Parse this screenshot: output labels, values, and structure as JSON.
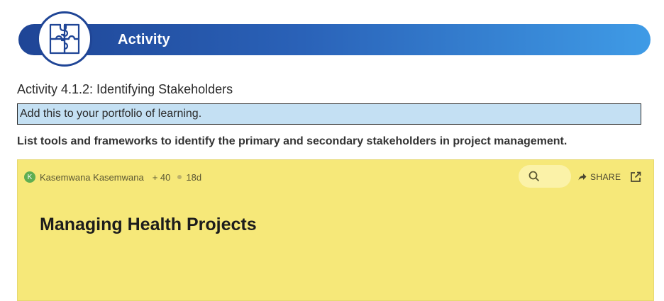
{
  "banner": {
    "title": "Activity",
    "icon": "puzzle-icon"
  },
  "activity": {
    "heading": "Activity 4.1.2: Identifying Stakeholders",
    "note": "Add this to your portfolio of learning.",
    "instruction": "List tools and frameworks to identify the primary and secondary stakeholders in project management."
  },
  "board": {
    "author_initial": "K",
    "author": "Kasemwana Kasemwana",
    "plus_count": "+ 40",
    "age": "18d",
    "share_label": "SHARE",
    "title": "Managing Health Projects"
  },
  "colors": {
    "banner_start": "#1f4596",
    "banner_end": "#3f9be6",
    "note_bg": "#c4e0f3",
    "board_bg": "#f6e879",
    "avatar": "#5fae52"
  }
}
